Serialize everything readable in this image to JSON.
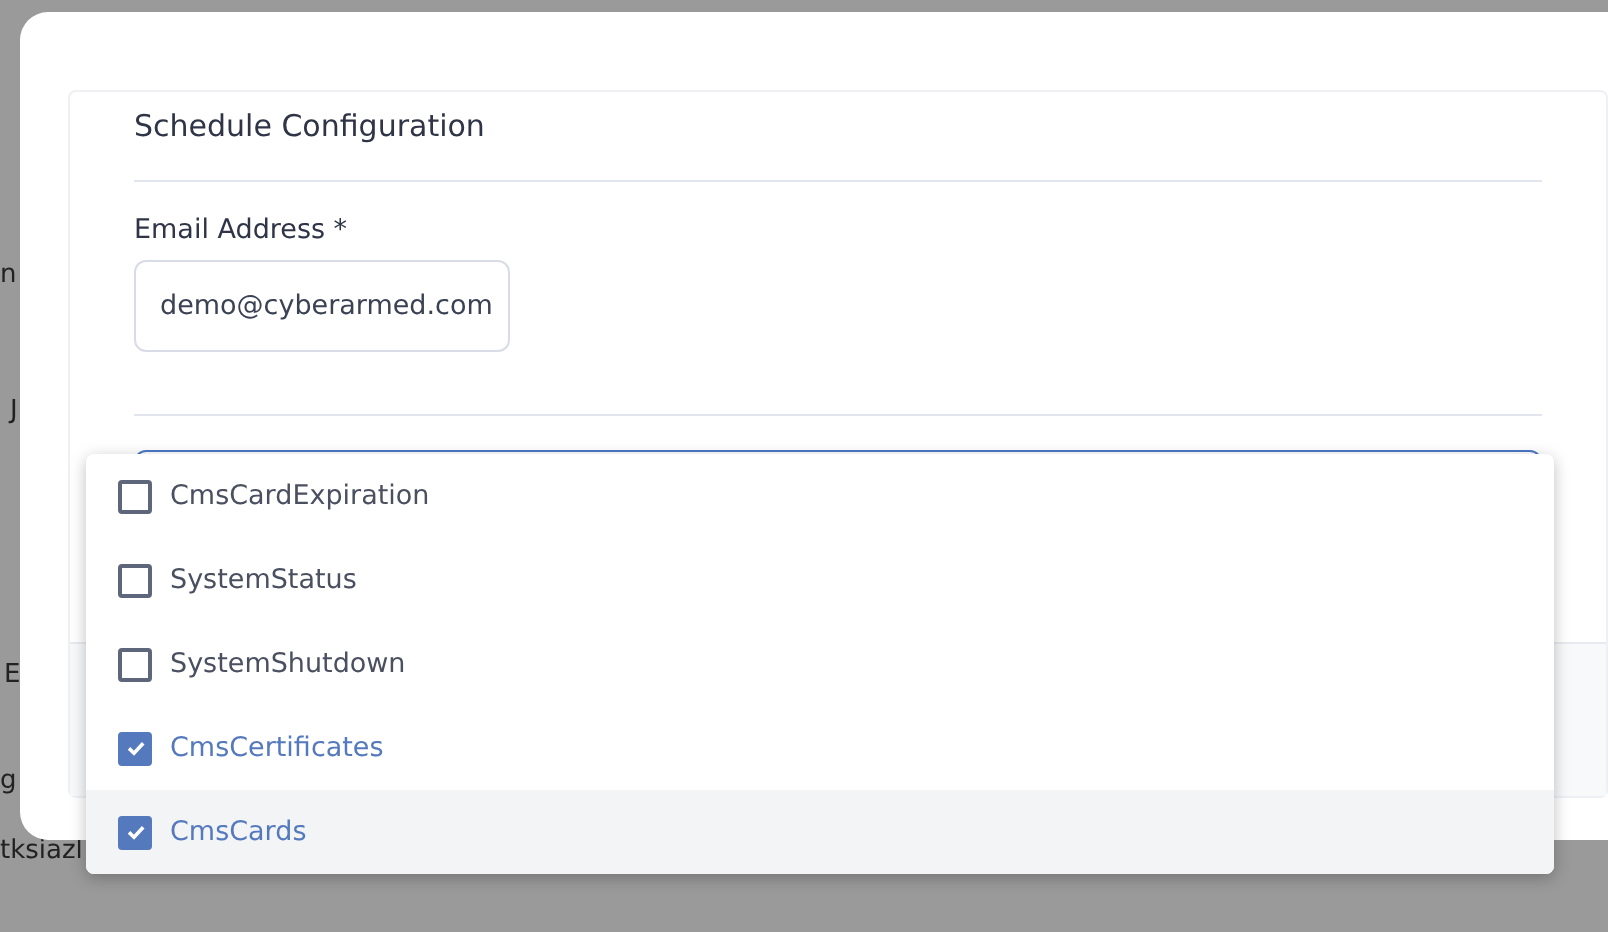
{
  "background_rows": [
    {
      "text": "n"
    },
    {
      "text": "J"
    },
    {
      "text": "E"
    },
    {
      "text": "g"
    },
    {
      "text": "tksiazl"
    }
  ],
  "modal": {
    "section_title": "Schedule Configuration",
    "email_field": {
      "label": "Email Address *",
      "value": "demo@cyberarmed.com"
    },
    "report_dropdown": {
      "options": [
        {
          "label": "CmsCardExpiration",
          "checked": false,
          "hovered": false
        },
        {
          "label": "SystemStatus",
          "checked": false,
          "hovered": false
        },
        {
          "label": "SystemShutdown",
          "checked": false,
          "hovered": false
        },
        {
          "label": "CmsCertificates",
          "checked": true,
          "hovered": false
        },
        {
          "label": "CmsCards",
          "checked": true,
          "hovered": true
        }
      ]
    }
  }
}
